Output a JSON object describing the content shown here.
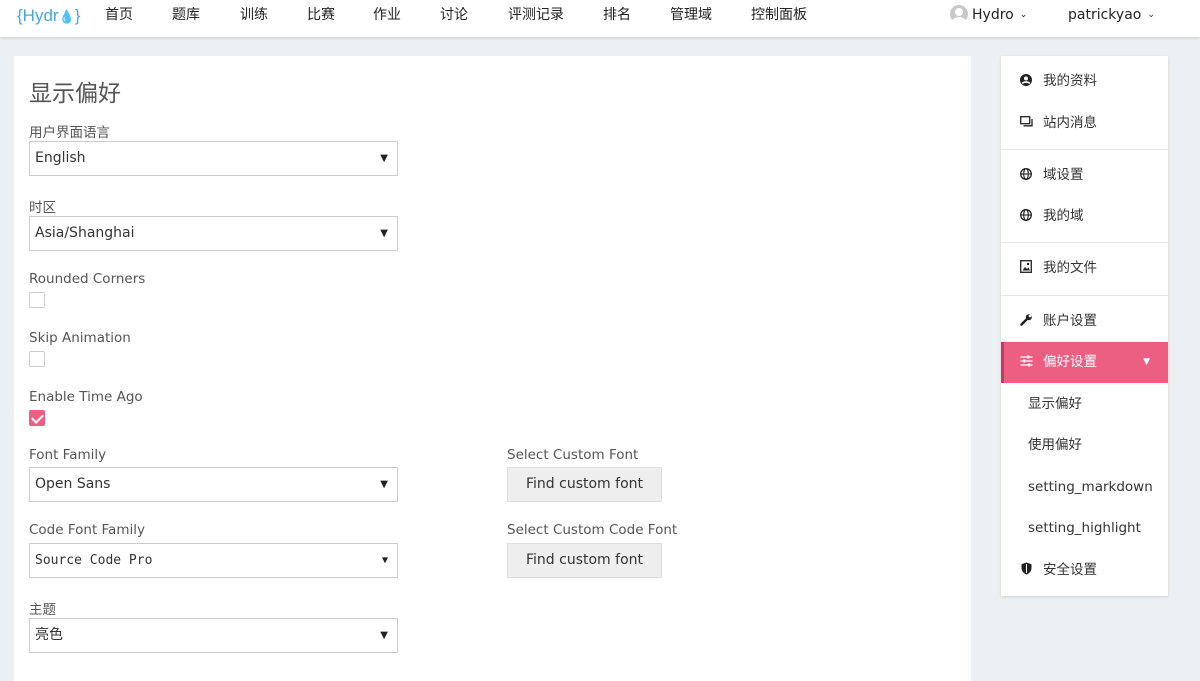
{
  "nav": {
    "logo_left": "{Hydr",
    "logo_drop": "💧",
    "logo_right": "}",
    "items": [
      "首页",
      "题库",
      "训练",
      "比赛",
      "作业",
      "讨论",
      "评测记录",
      "排名",
      "管理域",
      "控制面板"
    ],
    "domain_label": "Hydro",
    "user_label": "patrickyao",
    "caret": "⌄"
  },
  "main": {
    "title": "显示偏好",
    "ui_language": {
      "label": "用户界面语言",
      "value": "English"
    },
    "timezone": {
      "label": "时区",
      "value": "Asia/Shanghai"
    },
    "rounded_corners": {
      "label": "Rounded Corners",
      "checked": false
    },
    "skip_animation": {
      "label": "Skip Animation",
      "checked": false
    },
    "enable_time_ago": {
      "label": "Enable Time Ago",
      "checked": true
    },
    "font_family": {
      "label": "Font Family",
      "value": "Open Sans"
    },
    "custom_font": {
      "label": "Select Custom Font",
      "button": "Find custom font"
    },
    "code_font_family": {
      "label": "Code Font Family",
      "value": "Source Code Pro"
    },
    "custom_code_font": {
      "label": "Select Custom Code Font",
      "button": "Find custom font"
    },
    "theme": {
      "label": "主题",
      "value": "亮色"
    }
  },
  "sidebar": {
    "items": [
      {
        "label": "我的资料",
        "icon": "user-circle-icon"
      },
      {
        "label": "站内消息",
        "icon": "message-icon"
      },
      {
        "label": "域设置",
        "icon": "globe-icon"
      },
      {
        "label": "我的域",
        "icon": "globe-icon"
      },
      {
        "label": "我的文件",
        "icon": "file-image-icon"
      },
      {
        "label": "账户设置",
        "icon": "wrench-icon"
      },
      {
        "label": "偏好设置",
        "icon": "sliders-icon",
        "active": true
      },
      {
        "label": "显示偏好"
      },
      {
        "label": "使用偏好"
      },
      {
        "label": "setting_markdown"
      },
      {
        "label": "setting_highlight"
      },
      {
        "label": "安全设置",
        "icon": "shield-icon"
      }
    ]
  },
  "colors": {
    "accent": "#ed5f82",
    "logo": "#43a7e0",
    "background": "#edf0f2"
  }
}
